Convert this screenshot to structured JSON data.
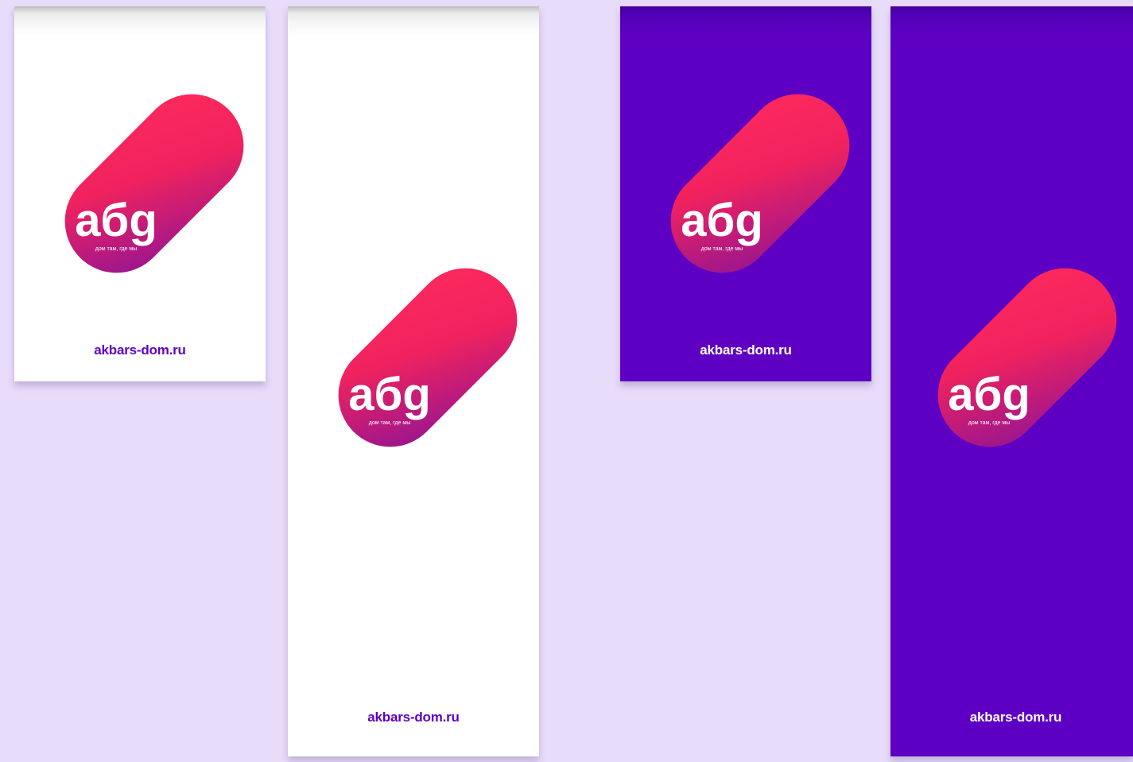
{
  "logo": {
    "word": "абg",
    "tagline": "дом там, где мы",
    "gradient_start": "#ff2a5d",
    "gradient_end": "#8e1496"
  },
  "site_label": "akbars-dom.ru",
  "colors": {
    "page_background": "#e8dcfb",
    "banner_white": "#ffffff",
    "banner_purple": "#5e00c4",
    "site_on_white": "#5e00c4",
    "site_on_purple": "#ffffff"
  }
}
